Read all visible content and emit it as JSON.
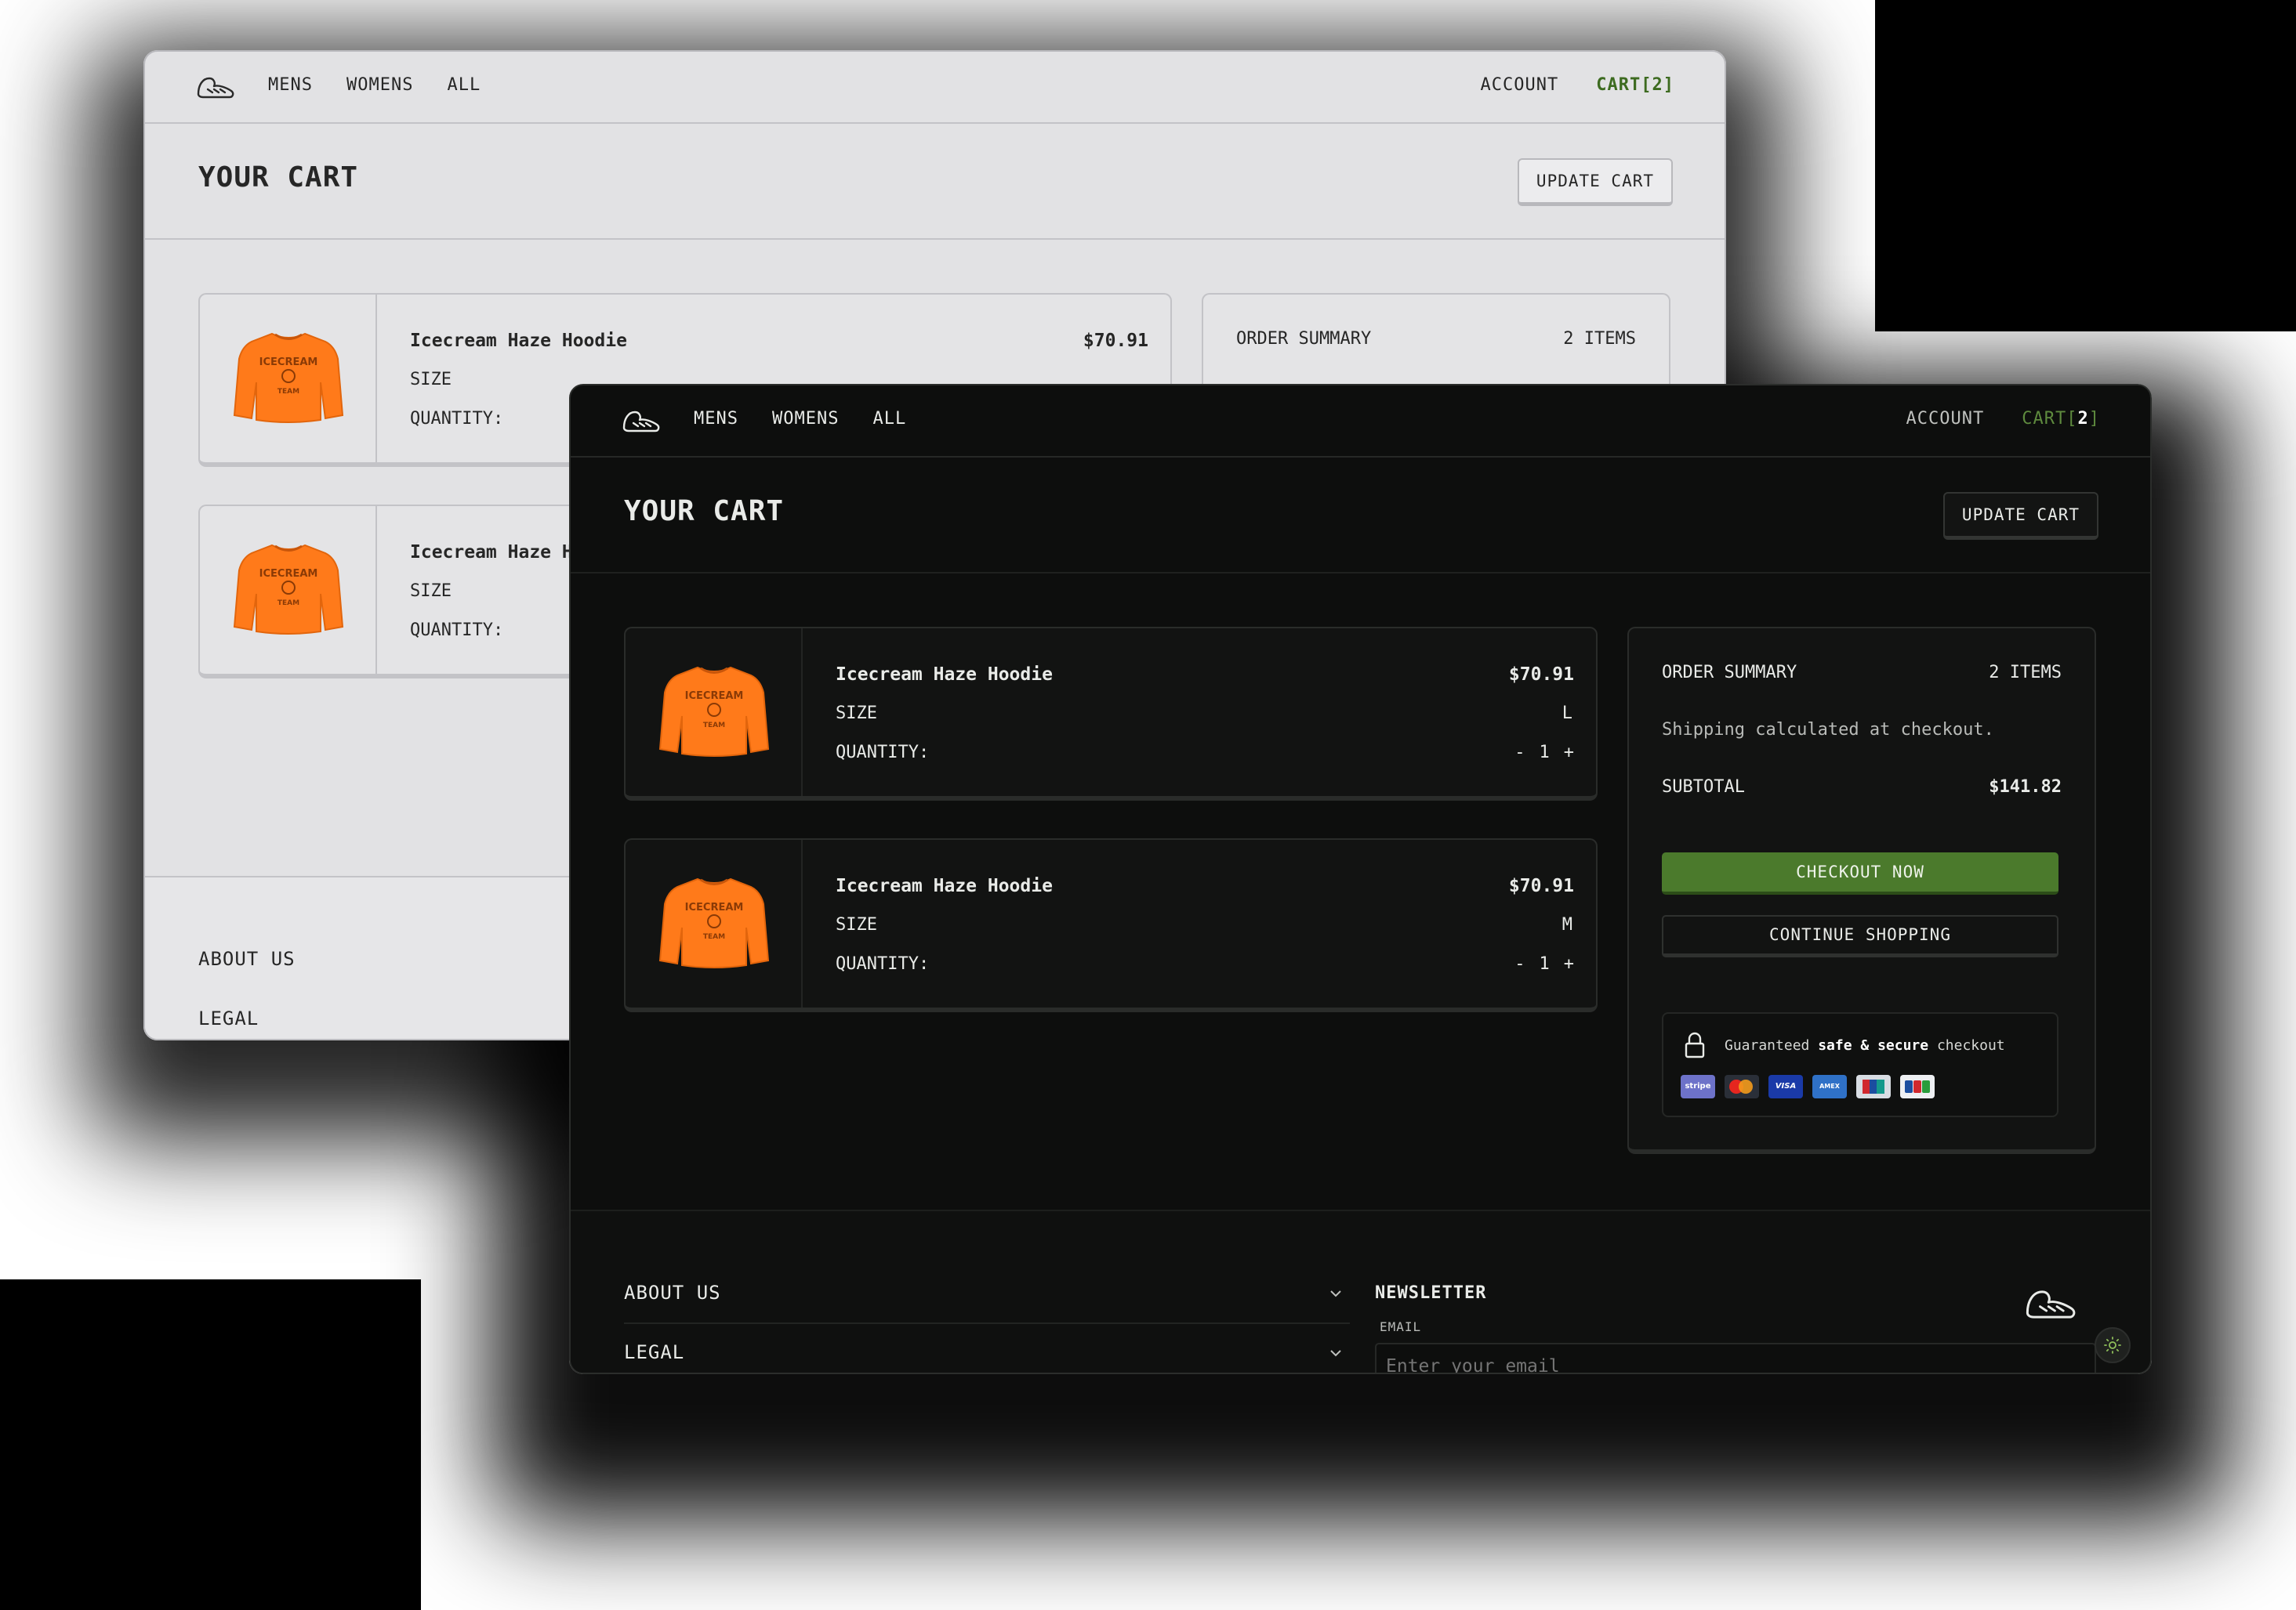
{
  "brand": {
    "accent": "#4b7a2c",
    "product_color": "#ff7a1a"
  },
  "nav": {
    "links": [
      "MENS",
      "WOMENS",
      "ALL"
    ],
    "account": "ACCOUNT",
    "cart_prefix": "CART[",
    "cart_count": "2",
    "cart_suffix": "]"
  },
  "cart": {
    "title": "YOUR CART",
    "update_label": "UPDATE CART",
    "size_label": "SIZE",
    "quantity_label": "QUANTITY:",
    "minus": "-",
    "plus": "+",
    "items": [
      {
        "name": "Icecream Haze Hoodie",
        "price": "$70.91",
        "size": "L",
        "quantity": "1",
        "print_top": "ICECREAM",
        "print_bottom": "TEAM"
      },
      {
        "name": "Icecream Haze Hoodie",
        "price": "$70.91",
        "size": "M",
        "quantity": "1",
        "print_top": "ICECREAM",
        "print_bottom": "TEAM"
      }
    ]
  },
  "summary": {
    "title": "ORDER SUMMARY",
    "items_count": "2 ITEMS",
    "shipping_note": "Shipping calculated at checkout.",
    "subtotal_label": "SUBTOTAL",
    "subtotal_value": "$141.82",
    "checkout_label": "CHECKOUT NOW",
    "continue_label": "CONTINUE SHOPPING",
    "secure": {
      "pre": "Guaranteed ",
      "bold": "safe & secure",
      "post": " checkout"
    },
    "payment_icons": [
      {
        "name": "stripe-icon",
        "label": "stripe"
      },
      {
        "name": "mastercard-icon",
        "label": ""
      },
      {
        "name": "visa-icon",
        "label": "VISA"
      },
      {
        "name": "amex-icon",
        "label": "AMEX"
      },
      {
        "name": "unionpay-icon",
        "label": ""
      },
      {
        "name": "jcb-icon",
        "label": ""
      }
    ]
  },
  "footer": {
    "about": "ABOUT US",
    "legal": "LEGAL",
    "newsletter_title": "NEWSLETTER",
    "email_label": "EMAIL",
    "email_placeholder": "Enter your email"
  }
}
